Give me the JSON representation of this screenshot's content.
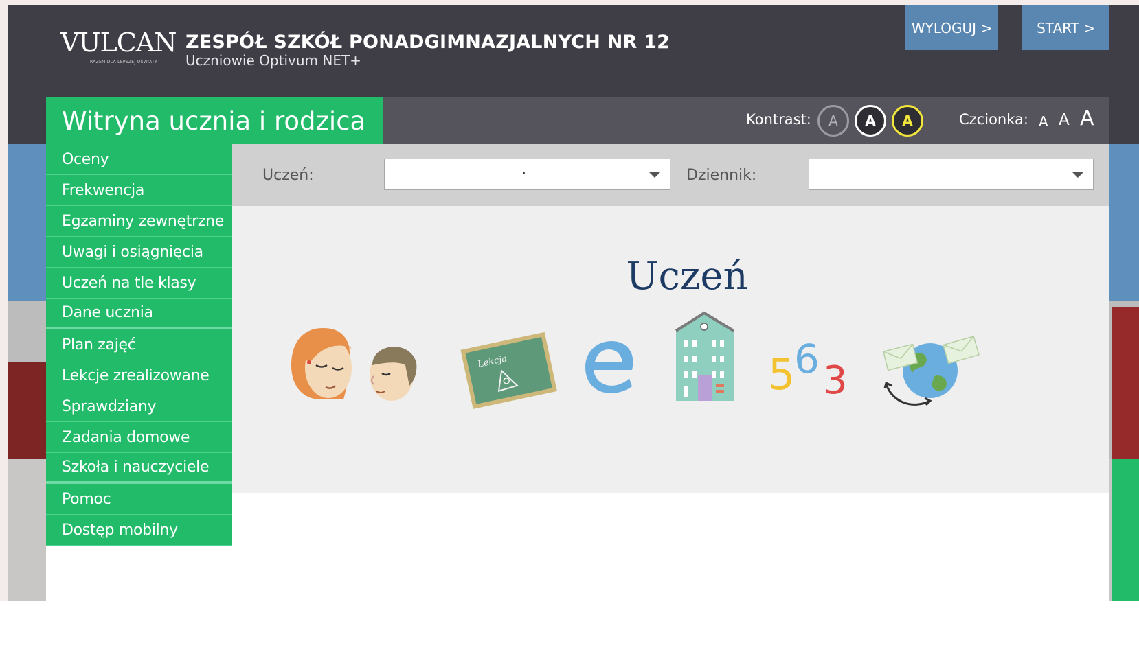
{
  "header": {
    "logo_text": "VULCAN",
    "logo_tagline": "RAZEM DLA LEPSZEJ OŚWIATY",
    "school_name": "ZESPÓŁ SZKÓŁ PONADGIMNAZJALNYCH NR 12",
    "school_subtitle": "Uczniowie Optivum NET+",
    "logout_label": "WYLOGUJ >",
    "start_label": "START >"
  },
  "title_bar": {
    "site_title": "Witryna ucznia i rodzica",
    "contrast_label": "Kontrast:",
    "contrast_options": [
      "A",
      "A",
      "A"
    ],
    "font_label": "Czcionka:",
    "font_options": [
      "A",
      "A",
      "A"
    ]
  },
  "sidebar": {
    "items": [
      {
        "label": "Oceny"
      },
      {
        "label": "Frekwencja"
      },
      {
        "label": "Egzaminy zewnętrzne"
      },
      {
        "label": "Uwagi i osiągnięcia"
      },
      {
        "label": "Uczeń na tle klasy"
      },
      {
        "label": "Dane ucznia"
      },
      {
        "label": "Plan zajęć"
      },
      {
        "label": "Lekcje zrealizowane"
      },
      {
        "label": "Sprawdziany"
      },
      {
        "label": "Zadania domowe"
      },
      {
        "label": "Szkoła i nauczyciele"
      },
      {
        "label": "Pomoc"
      },
      {
        "label": "Dostęp mobilny"
      }
    ]
  },
  "selectors": {
    "student_label": "Uczeń:",
    "student_value": "·",
    "journal_label": "Dziennik:",
    "journal_value": ""
  },
  "main": {
    "title": "Uczeń",
    "board_text": "Lekcja",
    "numbers": [
      "5",
      "6",
      "3"
    ],
    "icons": [
      "people-illustration",
      "chalkboard-illustration",
      "e-letter-illustration",
      "school-building-illustration",
      "numbers-illustration",
      "globe-mail-illustration"
    ]
  },
  "colors": {
    "header_bg": "#3f3e47",
    "accent_green": "#22bb6a",
    "button_blue": "#5a86b2",
    "title_blue": "#1c3a63",
    "contrast_yellow": "#f2e53b"
  }
}
